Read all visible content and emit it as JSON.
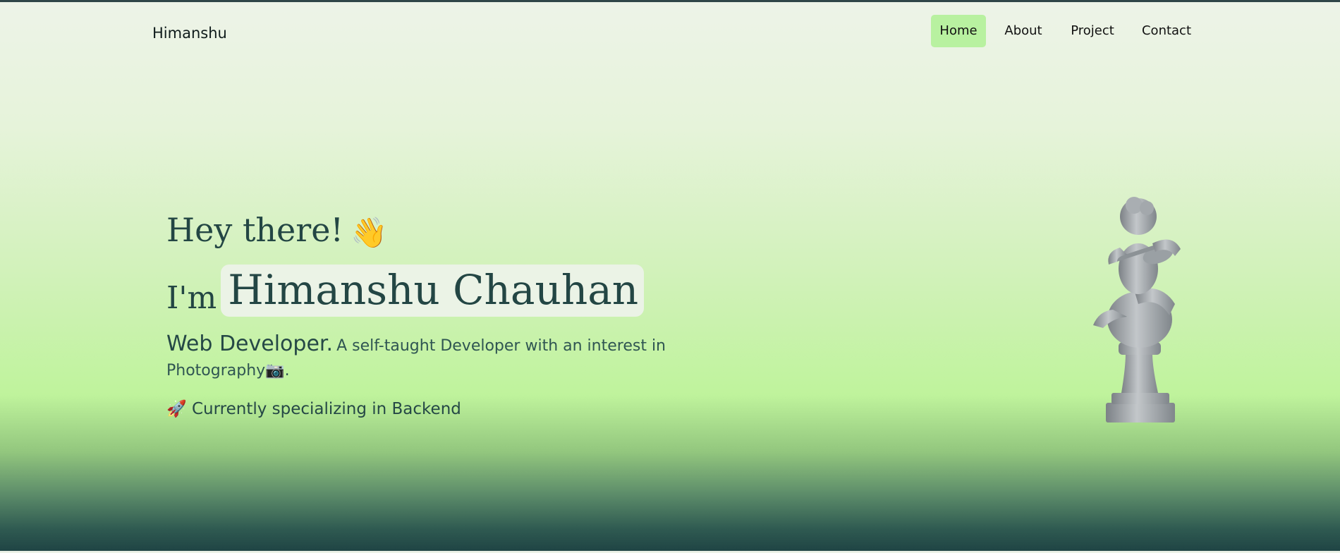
{
  "nav": {
    "brand": "Himanshu",
    "items": [
      {
        "label": "Home",
        "active": true
      },
      {
        "label": "About",
        "active": false
      },
      {
        "label": "Project",
        "active": false
      },
      {
        "label": "Contact",
        "active": false
      }
    ]
  },
  "hero": {
    "greeting": "Hey there!",
    "greeting_emoji": "👋",
    "intro_prefix": "I'm",
    "name": "Himanshu Chauhan",
    "role_title": "Web Developer.",
    "role_description": "A self-taught Developer with an interest in Photography",
    "role_emoji": "📷",
    "role_end": ".",
    "specialty_emoji": "🚀",
    "specialty": "Currently specializing in Backend"
  },
  "colors": {
    "accent": "#b8f1a0",
    "text_dark": "#234644",
    "gradient_bottom": "#1f4444"
  },
  "icons": {
    "wave": "waving-hand-icon",
    "camera": "camera-icon",
    "rocket": "rocket-icon",
    "statue": "cherub-statue-image"
  }
}
